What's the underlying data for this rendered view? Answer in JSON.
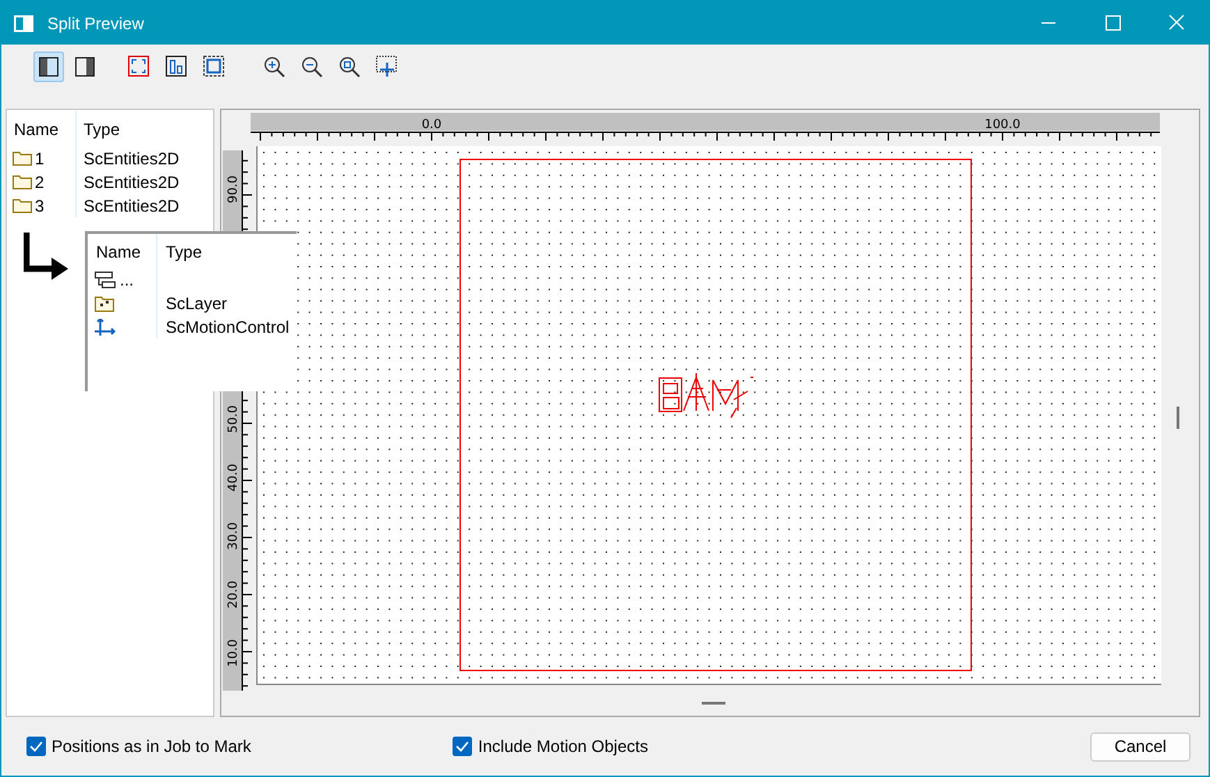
{
  "window": {
    "title": "Split Preview"
  },
  "toolbar": {
    "layout_buttons": [
      {
        "selected": true
      },
      {
        "selected": false
      }
    ]
  },
  "tree": {
    "columns": [
      "Name",
      "Type"
    ],
    "rows": [
      {
        "name": "1",
        "type": "ScEntities2D"
      },
      {
        "name": "2",
        "type": "ScEntities2D"
      },
      {
        "name": "3",
        "type": "ScEntities2D"
      }
    ]
  },
  "detail_popup": {
    "columns": [
      "Name",
      "Type"
    ],
    "rows": [
      {
        "kind": "group",
        "name": "..."
      },
      {
        "kind": "layer",
        "type": "ScLayer"
      },
      {
        "kind": "motion",
        "type": "ScMotionControl"
      }
    ]
  },
  "rulers": {
    "top_labels": [
      "0.0",
      "100.0"
    ],
    "left_labels": [
      "90.0",
      "50.0",
      "40.0",
      "30.0",
      "20.0",
      "10.0"
    ]
  },
  "options": [
    {
      "label": "Positions as in Job to Mark",
      "checked": true
    },
    {
      "label": "Include Motion Objects",
      "checked": true
    }
  ],
  "cancel_button": "Cancel"
}
